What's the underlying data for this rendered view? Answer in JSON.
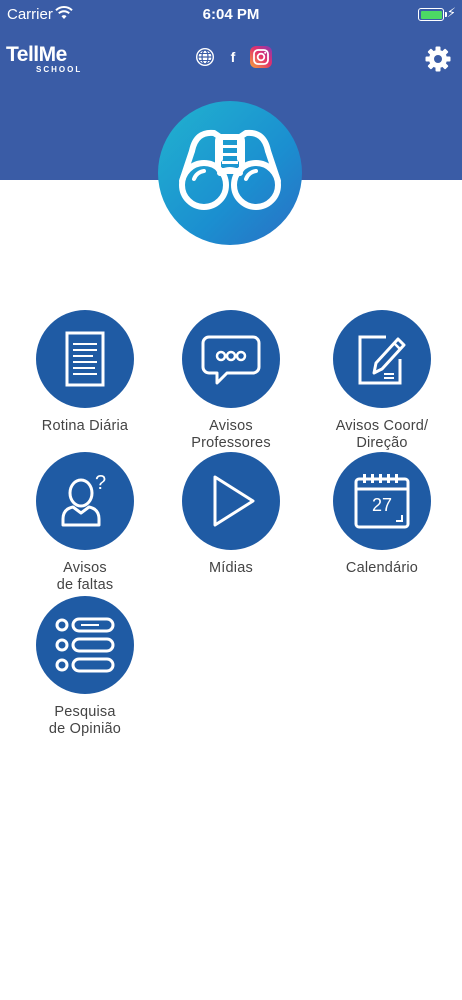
{
  "status_bar": {
    "carrier": "Carrier",
    "time": "6:04 PM"
  },
  "header": {
    "logo_main": "TellMe",
    "logo_sub": "SCHOOL",
    "social_icons": [
      "globe-icon",
      "facebook-icon",
      "instagram-icon"
    ],
    "facebook_glyph": "f",
    "colors": {
      "header_bg": "#3a5ca6",
      "tile_bg": "#1f5ba4",
      "hero_gradient_start": "#21b3cf",
      "hero_gradient_end": "#2a6fc4"
    }
  },
  "hero_icon": "binoculars-icon",
  "menu": [
    {
      "label": "Rotina Diária",
      "icon": "document-icon"
    },
    {
      "label": "Avisos\nProfessores",
      "icon": "speech-bubble-icon"
    },
    {
      "label": "Avisos Coord/\nDireção",
      "icon": "edit-pencil-icon"
    },
    {
      "label": "Avisos\nde faltas",
      "icon": "person-question-icon"
    },
    {
      "label": "Mídias",
      "icon": "play-icon"
    },
    {
      "label": "Calendário",
      "icon": "calendar-icon",
      "calendar_day": "27"
    },
    {
      "label": "Pesquisa\nde Opinião",
      "icon": "survey-list-icon"
    }
  ]
}
